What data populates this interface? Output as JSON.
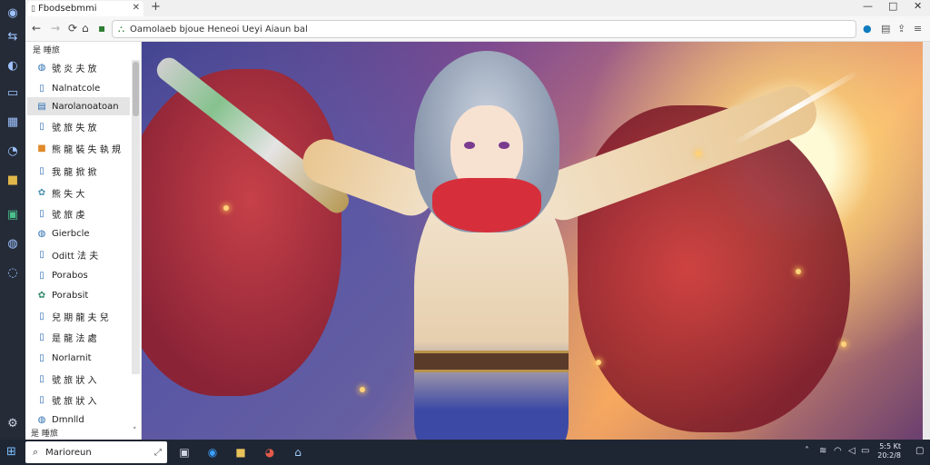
{
  "browser": {
    "tab_title": "Fbodsebmmi",
    "tab_icon": "page-icon",
    "address": "Oamolaeb bjoue  Heneoi  Ueyi  Aiaun  bal",
    "colors": {
      "accent": "#0f7bbf",
      "taskbar": "#1f2633"
    }
  },
  "sidebar": {
    "header": "是 睡旅",
    "items": [
      {
        "label": "號 炎 夫 放",
        "icon": "globe-icon"
      },
      {
        "label": "Nalnatcole",
        "icon": "document-icon"
      },
      {
        "label": "Narolanoatoan",
        "icon": "document-icon"
      },
      {
        "label": "號 旅 失 放",
        "icon": "document-icon"
      },
      {
        "label": "熊 龍 裝 失 執 規",
        "icon": "folder-icon"
      },
      {
        "label": "我 龍 掀 掀",
        "icon": "document-icon"
      },
      {
        "label": "熊 失 大",
        "icon": "settings-icon"
      },
      {
        "label": "號 旅 虔",
        "icon": "document-icon"
      },
      {
        "label": "Gierbcle",
        "icon": "globe-icon"
      },
      {
        "label": "Oditt 法 夫",
        "icon": "document-icon"
      },
      {
        "label": "Porabos",
        "icon": "document-icon"
      },
      {
        "label": "Porabsit",
        "icon": "settings-icon"
      },
      {
        "label": "兒 期 龍 夫 兒",
        "icon": "document-icon"
      },
      {
        "label": "是 龍 法 處",
        "icon": "document-icon"
      },
      {
        "label": "Norlarnit",
        "icon": "document-icon"
      },
      {
        "label": "號 旅 狀 入",
        "icon": "document-icon"
      },
      {
        "label": "號 旅 狀 入",
        "icon": "document-icon"
      },
      {
        "label": "Dmnlld",
        "icon": "globe-icon"
      }
    ],
    "footer": "是 睡旅"
  },
  "taskbar": {
    "search_text": "Marioreun",
    "clock_line1": "5:5 Kt",
    "clock_line2": "20:2/8"
  }
}
